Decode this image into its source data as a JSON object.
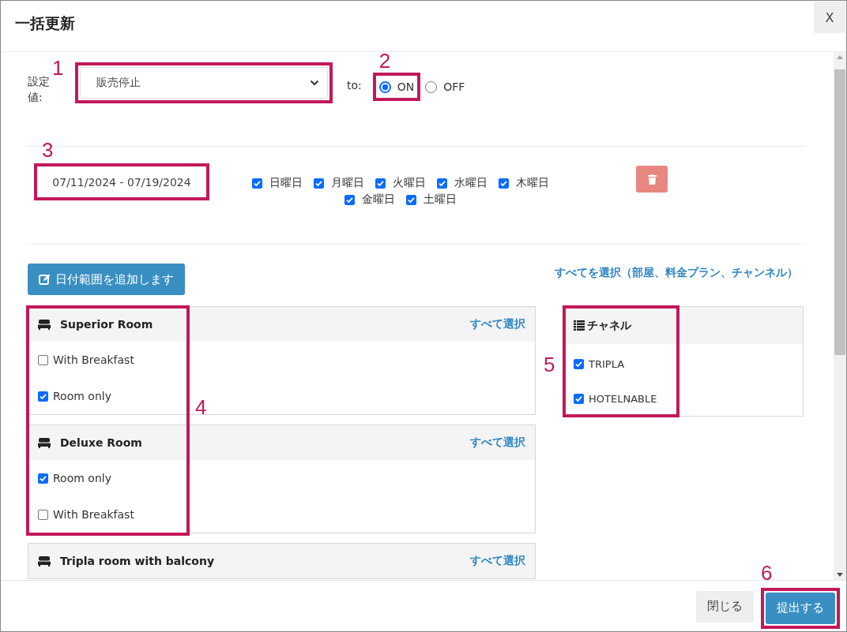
{
  "dialog": {
    "title": "一括更新",
    "close_label": "X"
  },
  "setting": {
    "label": "設定値:",
    "value": "販売停止",
    "callout": "1"
  },
  "target": {
    "label": "to:",
    "options": [
      {
        "label": "ON",
        "selected": true,
        "callout": "2"
      },
      {
        "label": "OFF",
        "selected": false
      }
    ]
  },
  "date_ranges": [
    {
      "range": "07/11/2024 - 07/19/2024",
      "callout": "3",
      "weekdays": [
        {
          "label": "日曜日",
          "checked": true
        },
        {
          "label": "月曜日",
          "checked": true
        },
        {
          "label": "火曜日",
          "checked": true
        },
        {
          "label": "水曜日",
          "checked": true
        },
        {
          "label": "木曜日",
          "checked": true
        },
        {
          "label": "金曜日",
          "checked": true
        },
        {
          "label": "土曜日",
          "checked": true
        }
      ]
    }
  ],
  "add_range_button": "日付範囲を追加します",
  "select_all_link": "すべてを選択（部屋、料金プラン、チャンネル）",
  "rooms_callout": "4",
  "rooms": [
    {
      "name": "Superior Room",
      "select_all": "すべて選択",
      "plans": [
        {
          "label": "With Breakfast",
          "checked": false
        },
        {
          "label": "Room only",
          "checked": true
        }
      ]
    },
    {
      "name": "Deluxe Room",
      "select_all": "すべて選択",
      "plans": [
        {
          "label": "Room only",
          "checked": true
        },
        {
          "label": "With Breakfast",
          "checked": false
        }
      ]
    },
    {
      "name": "Tripla room with balcony",
      "select_all": "すべて選択"
    }
  ],
  "channels": {
    "title": "チャネル",
    "callout": "5",
    "items": [
      {
        "label": "TRIPLA",
        "checked": true
      },
      {
        "label": "HOTELNABLE",
        "checked": true
      }
    ]
  },
  "footer": {
    "buttons": [
      {
        "label": "閉じる",
        "kind": "secondary"
      },
      {
        "label": "提出する",
        "kind": "primary",
        "callout": "6"
      }
    ]
  }
}
